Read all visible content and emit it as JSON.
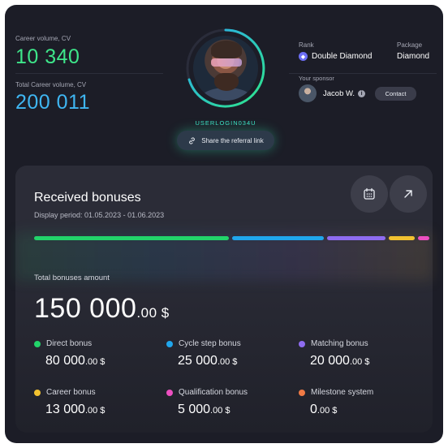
{
  "profile": {
    "career_volume_label": "Career volume, CV",
    "career_volume_value": "10 340",
    "total_career_volume_label": "Total Career volume, CV",
    "total_career_volume_value": "200 011",
    "login": "USERLOGIN034U",
    "share_label": "Share the referral link",
    "rank_label": "Rank",
    "rank_value": "Double Diamond",
    "package_label": "Package",
    "package_value": "Diamond",
    "sponsor_label": "Your sponsor",
    "sponsor_name": "Jacob W.",
    "contact_label": "Contact"
  },
  "bonuses": {
    "title": "Received bonuses",
    "period": "Display period: 01.05.2023 - 01.06.2023",
    "total_label": "Total bonuses amount",
    "total_main": "150 000",
    "total_dec": ".00 $",
    "distribution": [
      {
        "name": "Direct bonus",
        "share": 0.53,
        "color": "#22d46a"
      },
      {
        "name": "Cycle step bonus",
        "share": 0.25,
        "color": "#20a6ec"
      },
      {
        "name": "Matching bonus",
        "share": 0.16,
        "color": "#8e6cf0"
      },
      {
        "name": "Career bonus",
        "share": 0.07,
        "color": "#f2c230"
      },
      {
        "name": "Qualification bonus",
        "share": 0.03,
        "color": "#ec4fc0"
      }
    ],
    "items": [
      {
        "label": "Direct bonus",
        "main": "80 000",
        "dec": ".00 $",
        "color": "#22d46a"
      },
      {
        "label": "Cycle step bonus",
        "main": "25 000",
        "dec": ".00 $",
        "color": "#20a6ec"
      },
      {
        "label": "Matching bonus",
        "main": "20 000",
        "dec": ".00 $",
        "color": "#8e6cf0"
      },
      {
        "label": "Career bonus",
        "main": "13 000",
        "dec": ".00 $",
        "color": "#f2c230"
      },
      {
        "label": "Qualification bonus",
        "main": "5 000",
        "dec": ".00 $",
        "color": "#ec4fc0"
      },
      {
        "label": "Milestone system",
        "main": "0",
        "dec": ".00 $",
        "color": "#f07a45"
      }
    ]
  },
  "icons": {
    "share": "link-icon",
    "calendar": "calendar-icon",
    "open": "arrow-up-right-icon",
    "rank": "diamond-badge-icon",
    "info": "info-icon"
  }
}
